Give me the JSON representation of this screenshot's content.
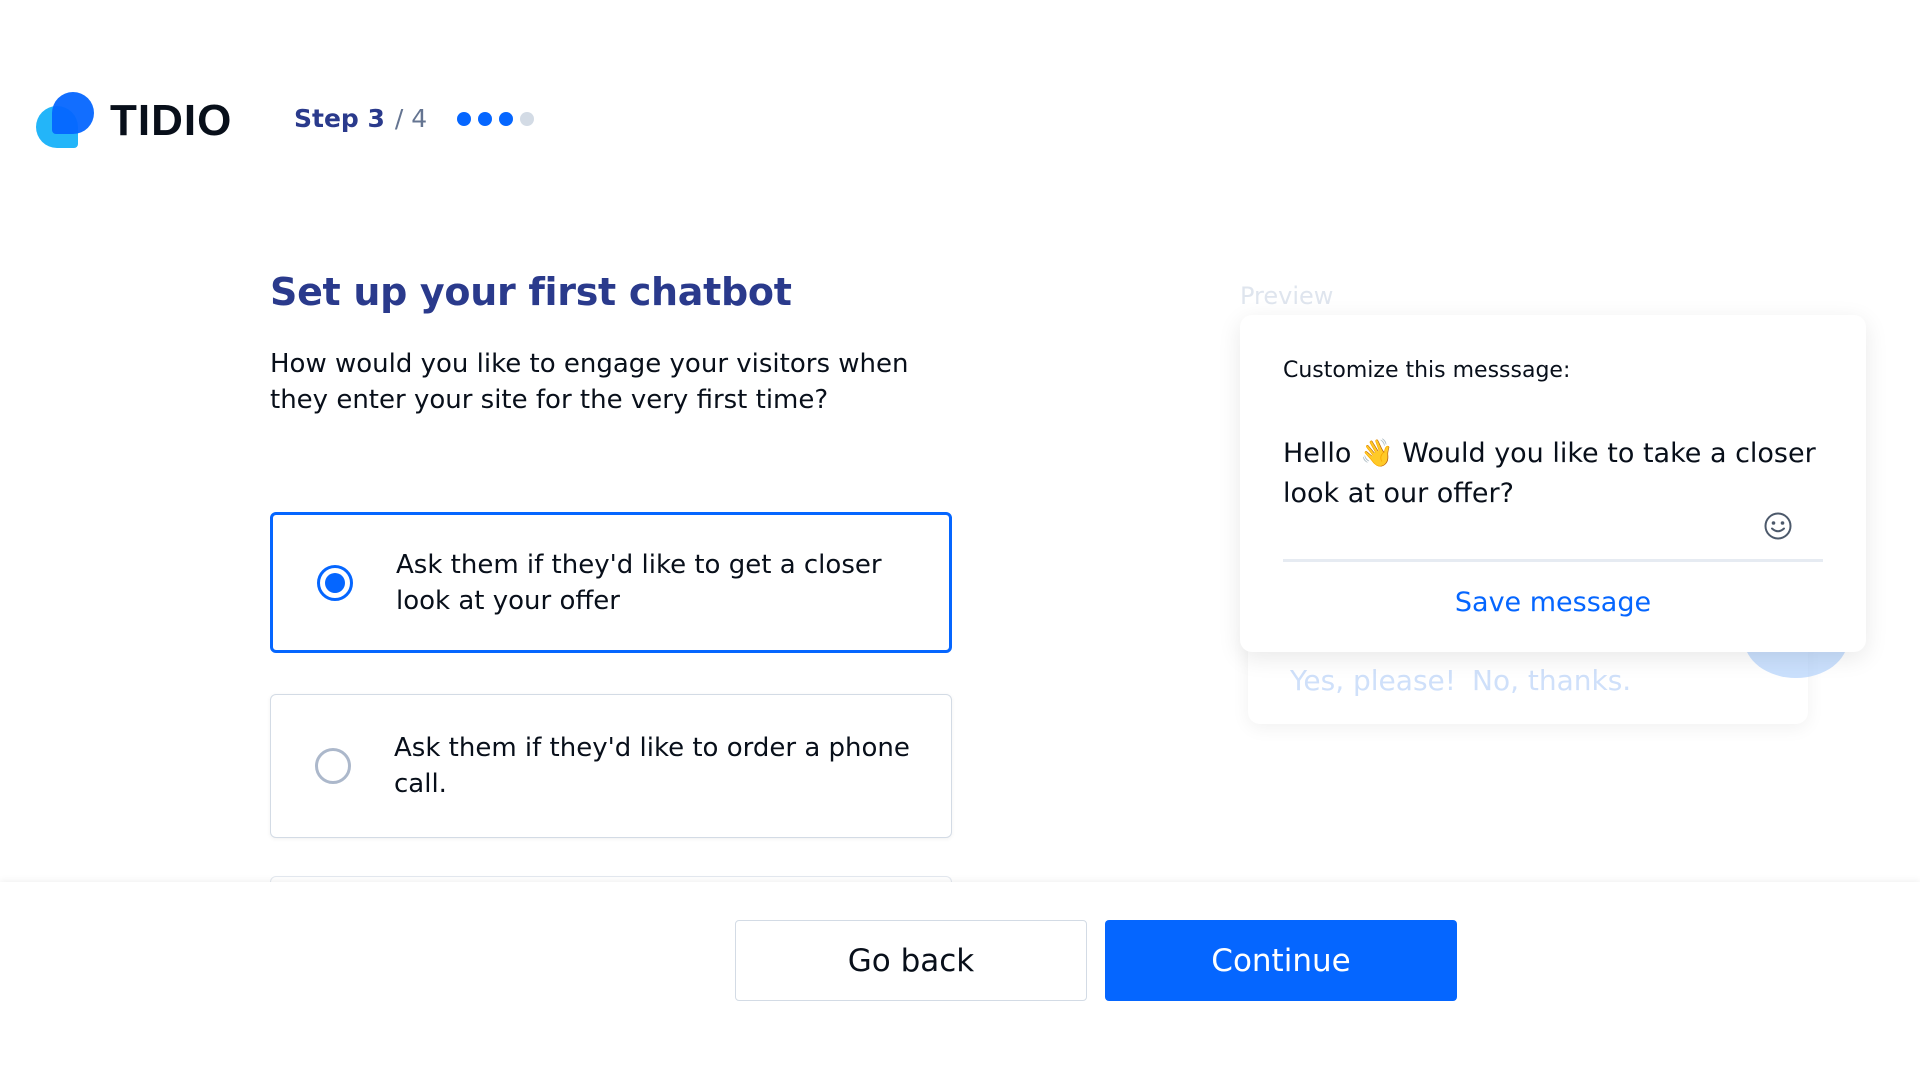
{
  "header": {
    "logo_text": "TIDIO",
    "step_current": "Step 3",
    "step_total": "/ 4",
    "steps_total": 4,
    "steps_done": 3
  },
  "main": {
    "title": "Set up your first chatbot",
    "subtitle": "How would you like to engage your visitors when they enter your site for the very first time?",
    "options": [
      {
        "label": "Ask them if they'd like to get a closer look at your offer",
        "selected": true
      },
      {
        "label": "Ask them if they'd like to order a phone call.",
        "selected": false
      }
    ]
  },
  "preview": {
    "label": "Preview",
    "card_label": "Customize this messsage:",
    "message": "Hello 👋 Would you like to take a closer look at our offer?",
    "save_label": "Save message",
    "quick_replies": [
      "Yes, please!",
      "No, thanks."
    ]
  },
  "footer": {
    "back_label": "Go back",
    "continue_label": "Continue"
  },
  "colors": {
    "accent": "#0566ff",
    "title": "#2a3a8c"
  }
}
